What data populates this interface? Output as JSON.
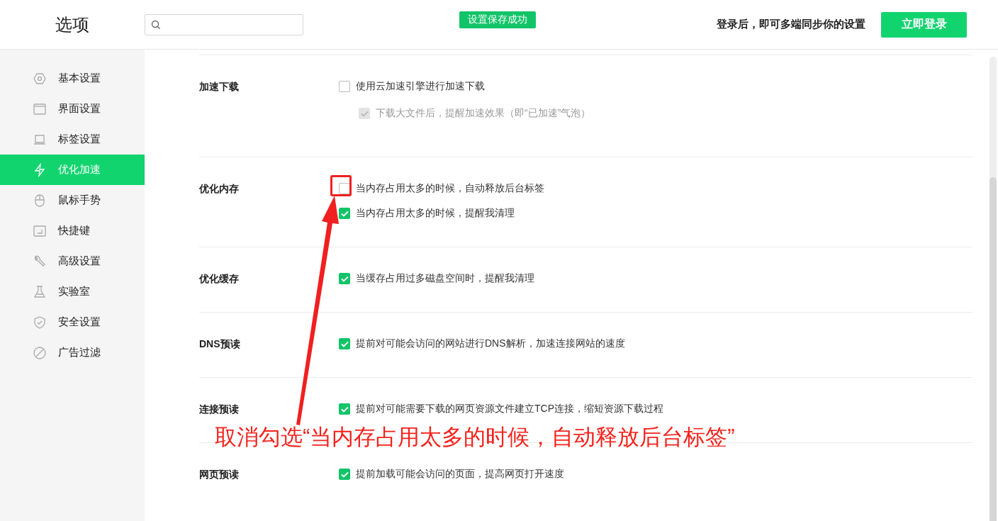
{
  "header": {
    "title": "选项",
    "toast": "设置保存成功",
    "sync_hint": "登录后，即可多端同步你的设置",
    "login_button": "立即登录"
  },
  "sidebar": {
    "items": [
      {
        "label": "基本设置",
        "selected": false
      },
      {
        "label": "界面设置",
        "selected": false
      },
      {
        "label": "标签设置",
        "selected": false
      },
      {
        "label": "优化加速",
        "selected": true
      },
      {
        "label": "鼠标手势",
        "selected": false
      },
      {
        "label": "快捷键",
        "selected": false
      },
      {
        "label": "高级设置",
        "selected": false
      },
      {
        "label": "实验室",
        "selected": false
      },
      {
        "label": "安全设置",
        "selected": false
      },
      {
        "label": "广告过滤",
        "selected": false
      }
    ]
  },
  "sections": [
    {
      "label": "加速下载",
      "options": [
        {
          "text": "使用云加速引擎进行加速下载",
          "checked": false,
          "disabled": false,
          "children": [
            {
              "text": "下载大文件后，提醒加速效果（即“已加速”气泡）",
              "checked": true,
              "disabled": true
            }
          ]
        }
      ]
    },
    {
      "label": "优化内存",
      "options": [
        {
          "text": "当内存占用太多的时候，自动释放后台标签",
          "checked": false,
          "disabled": false
        },
        {
          "text": "当内存占用太多的时候，提醒我清理",
          "checked": true,
          "disabled": false
        }
      ]
    },
    {
      "label": "优化缓存",
      "options": [
        {
          "text": "当缓存占用过多磁盘空间时，提醒我清理",
          "checked": true,
          "disabled": false
        }
      ]
    },
    {
      "label": "DNS预读",
      "options": [
        {
          "text": "提前对可能会访问的网站进行DNS解析，加速连接网站的速度",
          "checked": true,
          "disabled": false
        }
      ]
    },
    {
      "label": "连接预读",
      "options": [
        {
          "text": "提前对可能需要下载的网页资源文件建立TCP连接，缩短资源下载过程",
          "checked": true,
          "disabled": false
        }
      ]
    },
    {
      "label": "网页预读",
      "options": [
        {
          "text": "提前加载可能会访问的页面，提高网页打开速度",
          "checked": true,
          "disabled": false
        }
      ]
    }
  ],
  "annotation": {
    "caption": "取消勾选“当内存占用太多的时候，自动释放后台标签”"
  }
}
